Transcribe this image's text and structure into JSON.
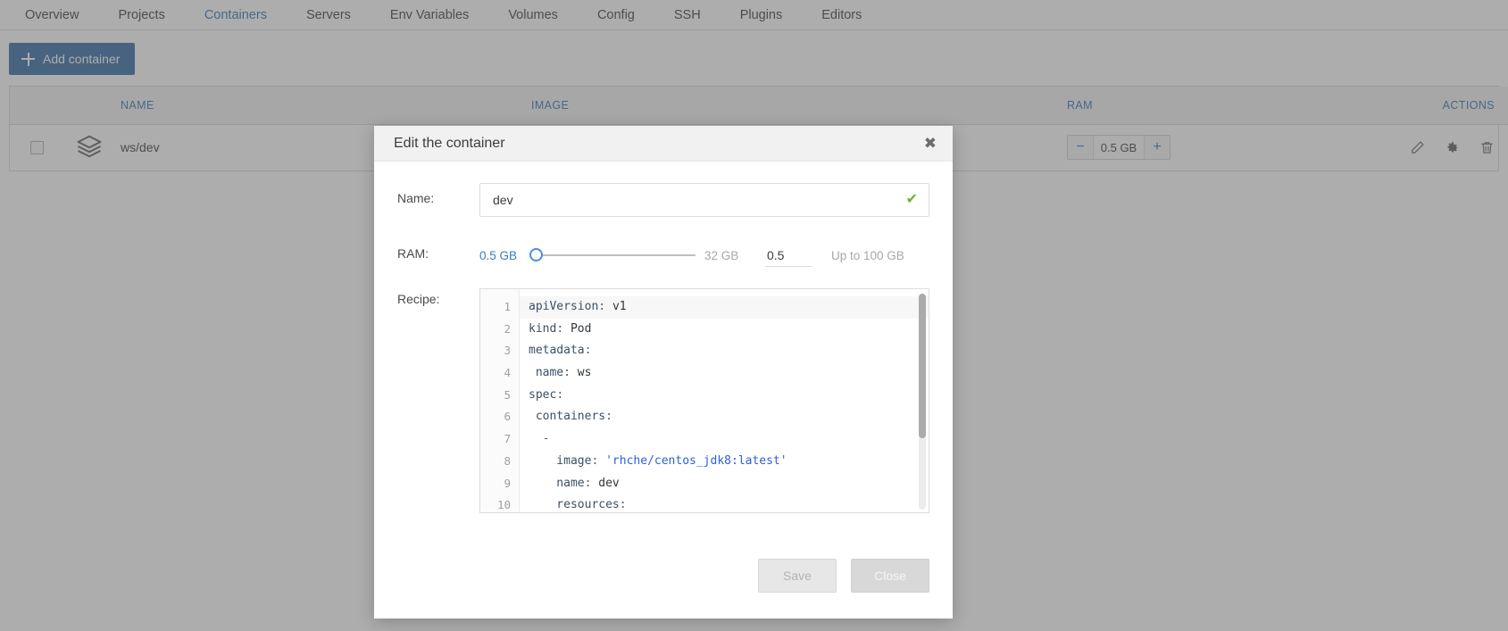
{
  "nav": {
    "items": [
      {
        "label": "Overview",
        "active": false
      },
      {
        "label": "Projects",
        "active": false
      },
      {
        "label": "Containers",
        "active": true
      },
      {
        "label": "Servers",
        "active": false
      },
      {
        "label": "Env Variables",
        "active": false
      },
      {
        "label": "Volumes",
        "active": false
      },
      {
        "label": "Config",
        "active": false
      },
      {
        "label": "SSH",
        "active": false
      },
      {
        "label": "Plugins",
        "active": false
      },
      {
        "label": "Editors",
        "active": false
      }
    ]
  },
  "toolbar": {
    "add_container_label": "Add container",
    "add_icon": "plus-icon",
    "accent_color": "#3f74ab"
  },
  "table": {
    "columns": [
      "NAME",
      "IMAGE",
      "RAM",
      "ACTIONS"
    ],
    "rows": [
      {
        "name": "ws/dev",
        "image": "",
        "ram_value": "0.5 GB",
        "minus_label": "−",
        "plus_label": "+",
        "icon": "container-stack-icon",
        "actions": [
          "edit-pencil-icon",
          "settings-gear-icon",
          "delete-trash-icon"
        ]
      }
    ]
  },
  "modal": {
    "title": "Edit the container",
    "close_label": "✖",
    "name": {
      "label": "Name:",
      "value": "dev",
      "placeholder": "",
      "valid_icon": "✔",
      "valid_color": "#6cb52d"
    },
    "ram": {
      "label": "RAM:",
      "min_label": "0.5 GB",
      "max_label": "32 GB",
      "input_value": "0.5",
      "hint": "Up to 100 GB",
      "slider_percent": 0
    },
    "recipe": {
      "label": "Recipe:",
      "lines": [
        {
          "n": "1",
          "parts": [
            {
              "t": "apiVersion",
              "c": "k"
            },
            {
              "t": ": ",
              "c": "p"
            },
            {
              "t": "v1",
              "c": ""
            }
          ]
        },
        {
          "n": "2",
          "parts": [
            {
              "t": "kind",
              "c": "k"
            },
            {
              "t": ": ",
              "c": "p"
            },
            {
              "t": "Pod",
              "c": ""
            }
          ]
        },
        {
          "n": "3",
          "parts": [
            {
              "t": "metadata",
              "c": "k"
            },
            {
              "t": ":",
              "c": "p"
            }
          ]
        },
        {
          "n": "4",
          "parts": [
            {
              "t": " name",
              "c": "k"
            },
            {
              "t": ": ",
              "c": "p"
            },
            {
              "t": "ws",
              "c": ""
            }
          ]
        },
        {
          "n": "5",
          "parts": [
            {
              "t": "spec",
              "c": "k"
            },
            {
              "t": ":",
              "c": "p"
            }
          ]
        },
        {
          "n": "6",
          "parts": [
            {
              "t": " containers",
              "c": "k"
            },
            {
              "t": ":",
              "c": "p"
            }
          ]
        },
        {
          "n": "7",
          "parts": [
            {
              "t": "  -",
              "c": "p"
            }
          ]
        },
        {
          "n": "8",
          "parts": [
            {
              "t": "    image",
              "c": "k"
            },
            {
              "t": ": ",
              "c": "p"
            },
            {
              "t": "'rhche/centos_jdk8:latest'",
              "c": "s"
            }
          ]
        },
        {
          "n": "9",
          "parts": [
            {
              "t": "    name",
              "c": "k"
            },
            {
              "t": ": ",
              "c": "p"
            },
            {
              "t": "dev",
              "c": ""
            }
          ]
        },
        {
          "n": "10",
          "parts": [
            {
              "t": "    resources",
              "c": "k"
            },
            {
              "t": ":",
              "c": "p"
            }
          ]
        }
      ],
      "scroll_thumb_percent": 67
    },
    "save_label": "Save",
    "close_button_label": "Close"
  }
}
